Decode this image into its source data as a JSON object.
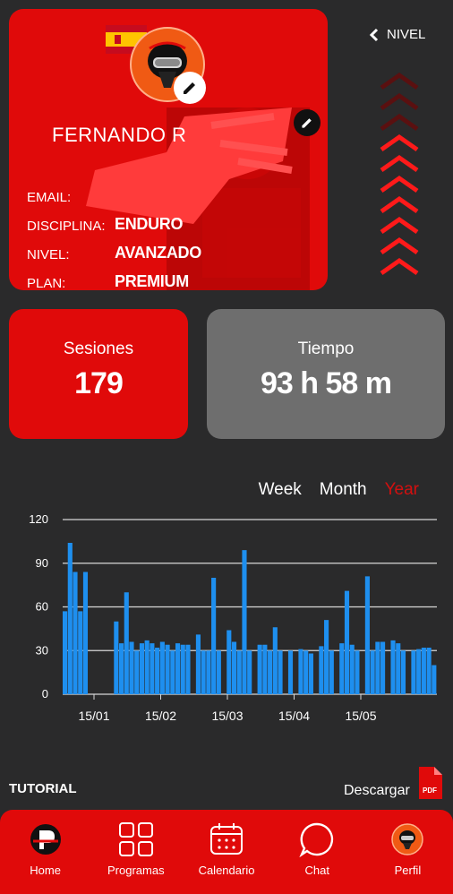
{
  "profile": {
    "name": "FERNANDO R",
    "fields": [
      {
        "label": "EMAIL:",
        "value": ""
      },
      {
        "label": "DISCIPLINA:",
        "value": "ENDURO"
      },
      {
        "label": "NIVEL:",
        "value": "AVANZADO"
      },
      {
        "label": "PLAN:",
        "value": "PREMIUM"
      }
    ]
  },
  "nivel": {
    "label": "NIVEL",
    "filled": 7,
    "total": 10
  },
  "stats": {
    "sessions_title": "Sesiones",
    "sessions_value": "179",
    "time_title": "Tiempo",
    "time_value": "93 h 58 m"
  },
  "tabs": [
    "Week",
    "Month",
    "Year"
  ],
  "active_tab": "Year",
  "chart_data": {
    "type": "bar",
    "color": "#1e8fef",
    "ylim": [
      0,
      120
    ],
    "yticks": [
      0,
      30,
      60,
      90,
      120
    ],
    "xtick_labels": [
      "15/01",
      "15/02",
      "15/03",
      "15/04",
      "15/05"
    ],
    "values": [
      57,
      104,
      84,
      57,
      84,
      0,
      0,
      0,
      0,
      0,
      50,
      35,
      70,
      36,
      30,
      35,
      37,
      35,
      32,
      36,
      34,
      30,
      35,
      34,
      34,
      0,
      41,
      30,
      30,
      80,
      30,
      0,
      44,
      36,
      30,
      99,
      30,
      0,
      34,
      34,
      30,
      46,
      30,
      0,
      30,
      0,
      31,
      30,
      28,
      0,
      33,
      51,
      30,
      0,
      35,
      71,
      34,
      30,
      0,
      81,
      30,
      36,
      36,
      0,
      37,
      35,
      30,
      0,
      30,
      31,
      32,
      32,
      20
    ]
  },
  "tutorial": {
    "label": "TUTORIAL",
    "download": "Descargar"
  },
  "nav": [
    {
      "label": "Home",
      "icon": "home-logo-icon"
    },
    {
      "label": "Programas",
      "icon": "grid-icon"
    },
    {
      "label": "Calendario",
      "icon": "calendar-icon"
    },
    {
      "label": "Chat",
      "icon": "chat-icon"
    },
    {
      "label": "Perfil",
      "icon": "profile-avatar-icon"
    }
  ]
}
